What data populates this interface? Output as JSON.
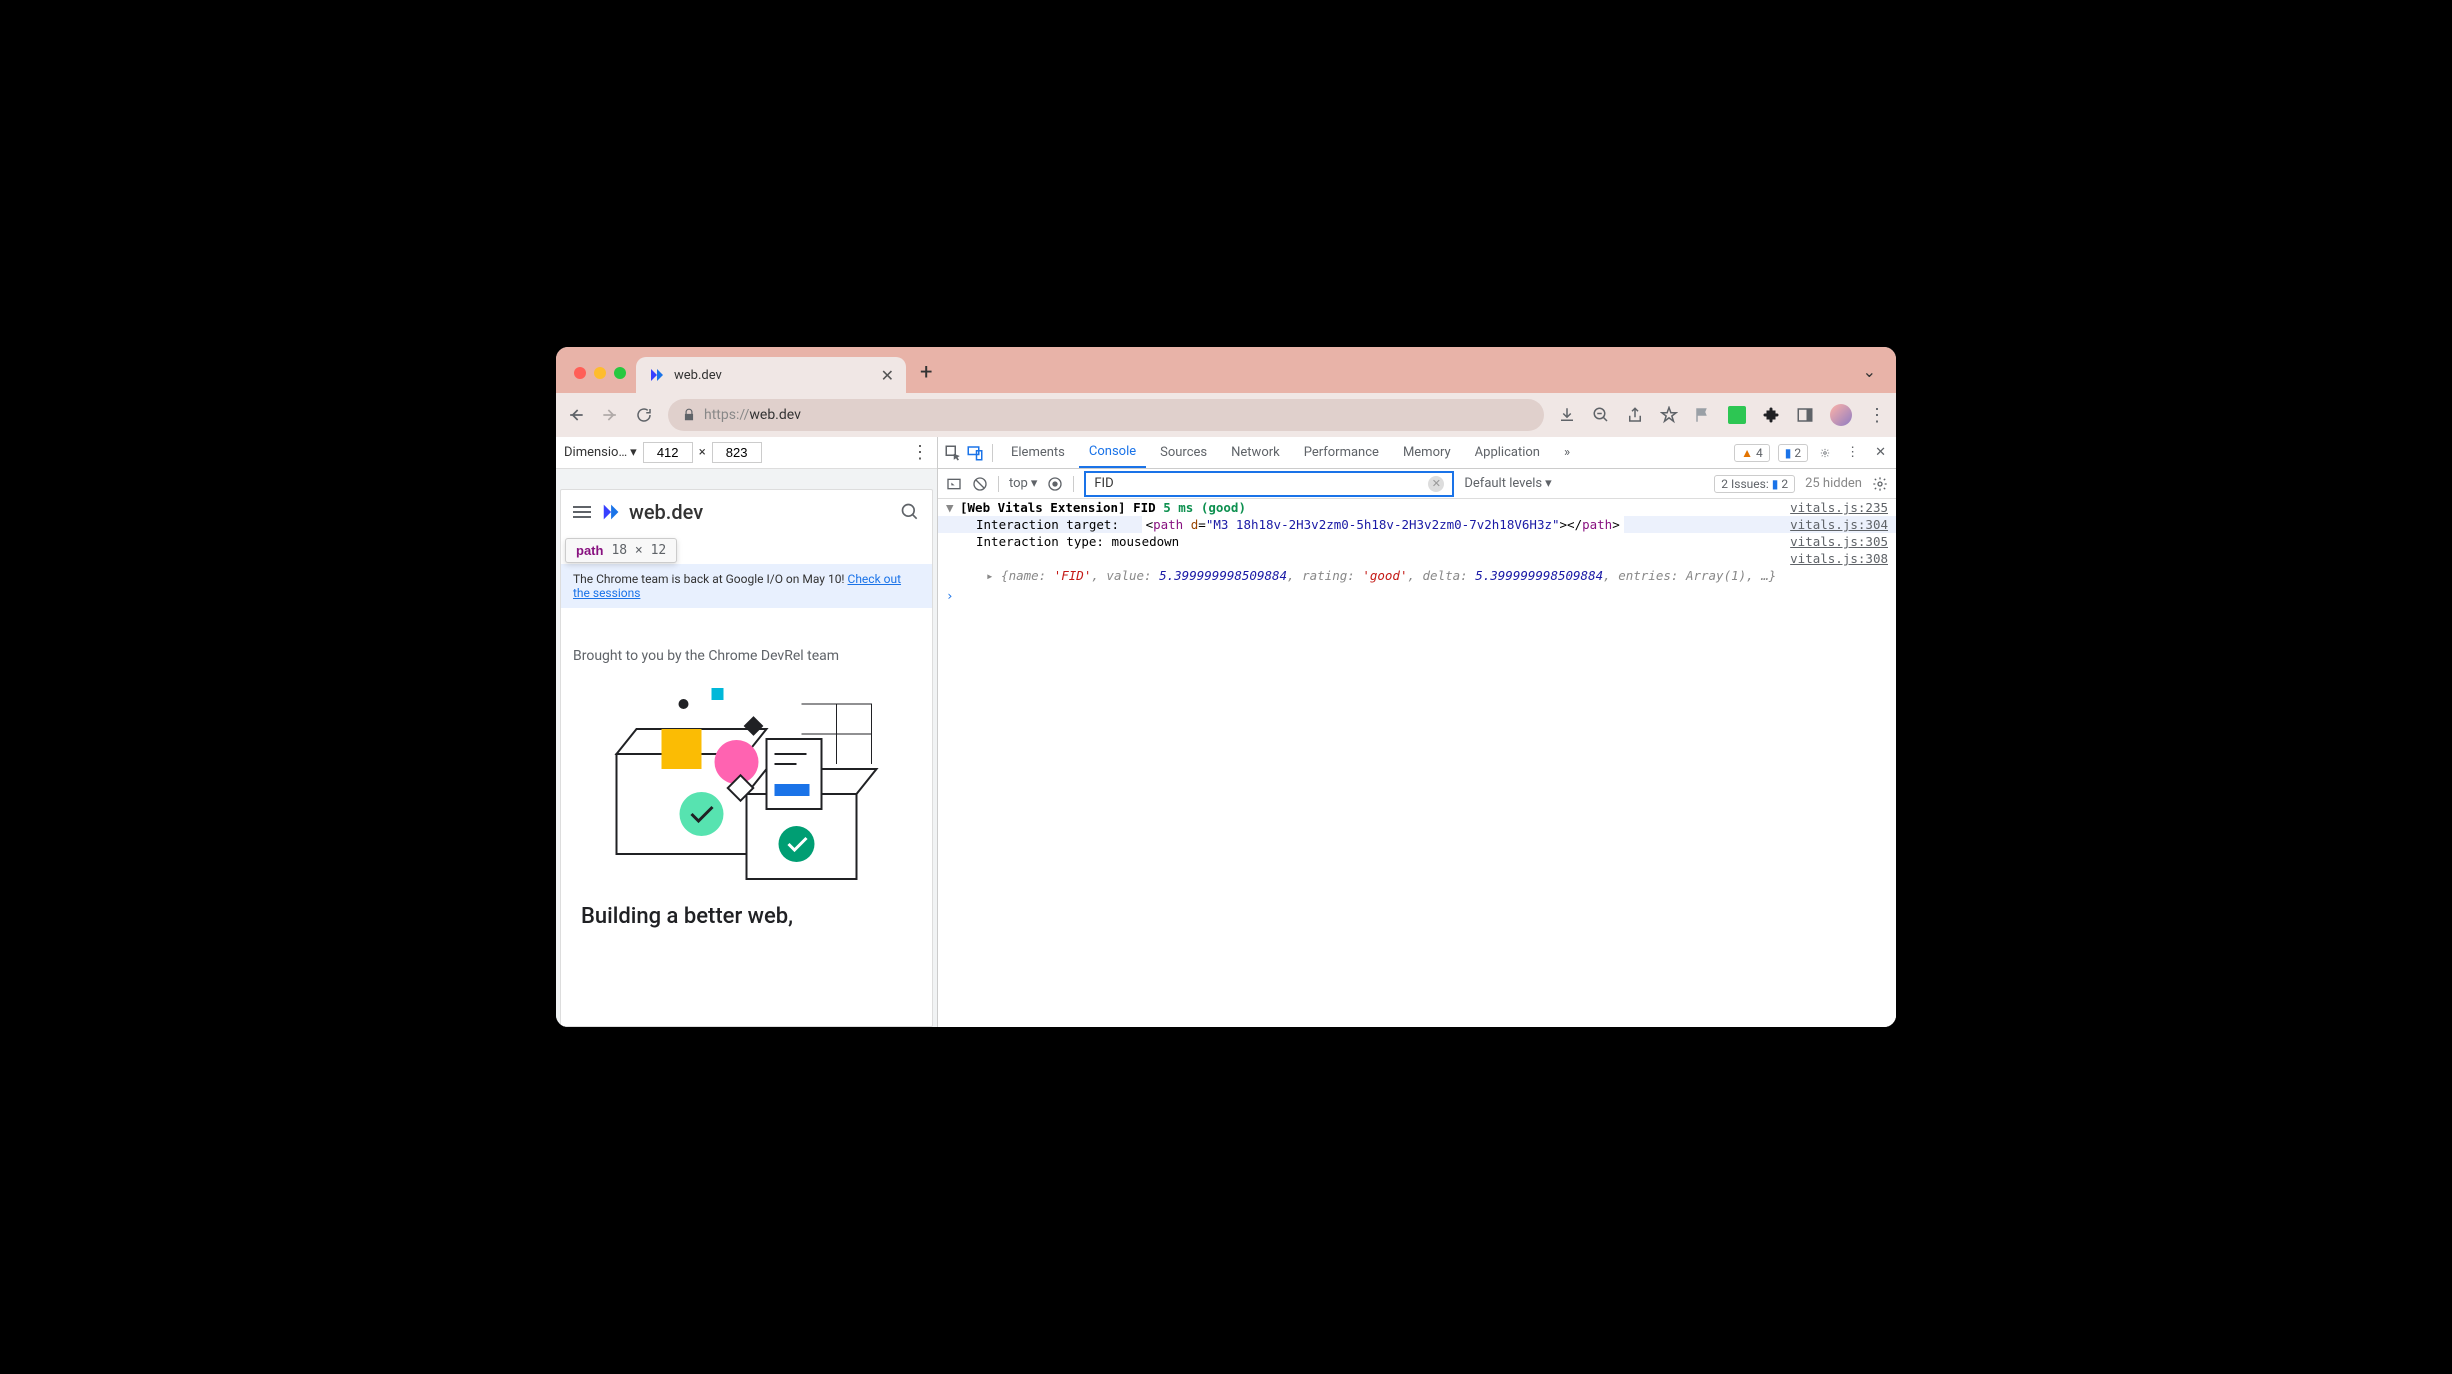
{
  "chrome": {
    "tab_title": "web.dev",
    "close_glyph": "✕",
    "new_tab_glyph": "+",
    "caret_glyph": "⌄",
    "url_scheme": "https://",
    "url_host": "web.dev"
  },
  "device_toolbar": {
    "dimensions_label": "Dimensio…",
    "width": "412",
    "times": "×",
    "height": "823",
    "more": "⋮"
  },
  "tooltip": {
    "element": "path",
    "dims": "18 × 12"
  },
  "mini_page": {
    "brand": "web.dev",
    "banner_text": "The Chrome team is back at Google I/O on May 10! ",
    "banner_link": "Check out the sessions",
    "hero_sub": "Brought to you by the Chrome DevRel team",
    "hero_h1": "Building a better web,"
  },
  "devtools": {
    "tabs": [
      "Elements",
      "Console",
      "Sources",
      "Network",
      "Performance",
      "Memory",
      "Application"
    ],
    "active_tab": "Console",
    "more_tabs": "»",
    "warn_count": "4",
    "msg_count": "2"
  },
  "console_toolbar": {
    "context": "top",
    "filter_value": "FID",
    "levels": "Default levels",
    "issues_label": "2 Issues:",
    "issues_count": "2",
    "hidden": "25 hidden"
  },
  "console": {
    "group_prefix": "[Web Vitals Extension] FID",
    "group_value": "5 ms (good)",
    "src_group": "vitals.js:235",
    "line_target_label": "Interaction target:",
    "path_d": "\"M3 18h18v-2H3v2zm0-5h18v-2H3v2zm0-7v2h18V6H3z\"",
    "src_target": "vitals.js:304",
    "line_type_label": "Interaction type: ",
    "line_type_value": "mousedown",
    "src_type": "vitals.js:305",
    "src_obj": "vitals.js:308",
    "obj_name": "'FID'",
    "obj_value": "5.399999998509884",
    "obj_rating": "'good'",
    "obj_delta": "5.399999998509884",
    "obj_entries": "Array(1)",
    "obj_rest": ", …}"
  }
}
